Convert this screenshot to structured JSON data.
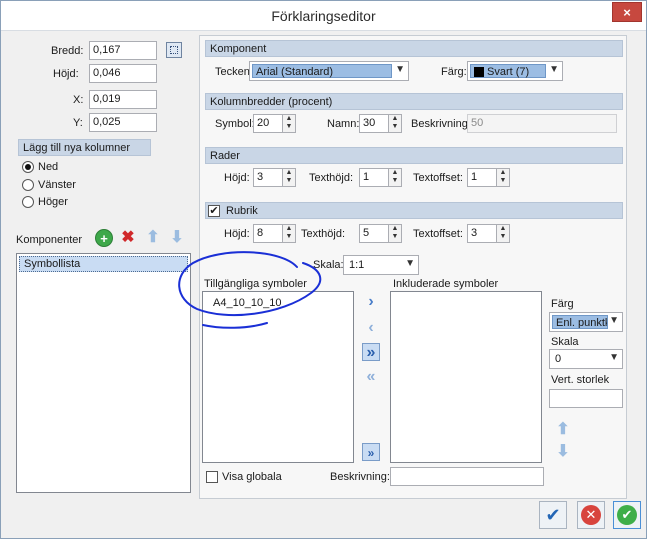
{
  "window": {
    "title": "Förklaringseditor",
    "close_glyph": "×"
  },
  "left": {
    "bredd_label": "Bredd:",
    "bredd_value": "0,167",
    "hojd_label": "Höjd:",
    "hojd_value": "0,046",
    "x_label": "X:",
    "x_value": "0,019",
    "y_label": "Y:",
    "y_value": "0,025",
    "add_columns_header": "Lägg till nya kolumner",
    "radio_ned": "Ned",
    "radio_vanster": "Vänster",
    "radio_hoger": "Höger",
    "components_label": "Komponenter",
    "components_list": [
      "Symbollista"
    ]
  },
  "komponent": {
    "header": "Komponent",
    "tecken_label": "Tecken:",
    "tecken_value": "Arial (Standard)",
    "farg_label": "Färg:",
    "farg_value": "Svart (7)",
    "farg_color": "#000000"
  },
  "kolumnbredder": {
    "header": "Kolumnbredder (procent)",
    "symbol_label": "Symbol:",
    "symbol_value": "20",
    "namn_label": "Namn:",
    "namn_value": "30",
    "beskrivning_label": "Beskrivning:",
    "beskrivning_value": "50"
  },
  "rader": {
    "header": "Rader",
    "hojd_label": "Höjd:",
    "hojd_value": "3",
    "texthojd_label": "Texthöjd:",
    "texthojd_value": "1",
    "textoffset_label": "Textoffset:",
    "textoffset_value": "1"
  },
  "rubrik": {
    "header": "Rubrik",
    "checked": true,
    "hojd_label": "Höjd:",
    "hojd_value": "8",
    "texthojd_label": "Texthöjd:",
    "texthojd_value": "5",
    "textoffset_label": "Textoffset:",
    "textoffset_value": "3"
  },
  "symbols": {
    "skala_label": "Skala:",
    "skala_value": "1:1",
    "available_label": "Tillgängliga symboler",
    "available_items": [
      "A4_10_10_10"
    ],
    "included_label": "Inkluderade symboler",
    "farg_label": "Färg",
    "farg_value": "Enl. punktk",
    "skala_label2": "Skala",
    "skala_value2": "0",
    "vert_label": "Vert. storlek",
    "vert_value": "",
    "visa_globala_label": "Visa globala",
    "beskrivning_label": "Beskrivning:",
    "beskrivning_value": ""
  },
  "annotation_color": "#1a2fd6"
}
